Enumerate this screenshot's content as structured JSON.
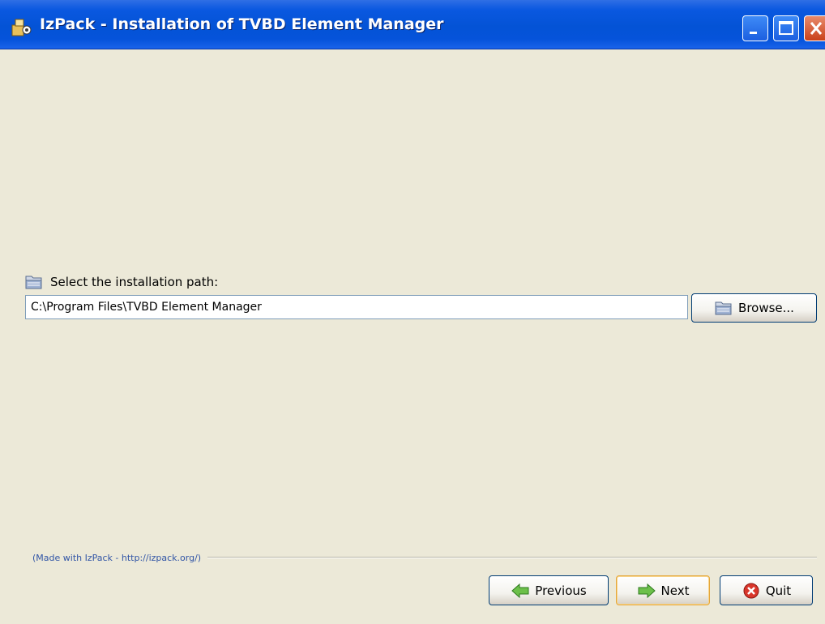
{
  "window": {
    "title": "IzPack - Installation of TVBD Element Manager",
    "icons": {
      "app": "izpack-app-icon",
      "minimize": "minimize-icon",
      "maximize": "maximize-icon",
      "close": "close-icon"
    }
  },
  "panel": {
    "path_label": "Select the installation path:",
    "path_value": "C:\\Program Files\\TVBD Element Manager",
    "browse_label": "Browse..."
  },
  "footer": {
    "made_with": "(Made with IzPack - http://izpack.org/)"
  },
  "buttons": {
    "previous_label": "Previous",
    "next_label": "Next",
    "quit_label": "Quit"
  },
  "colors": {
    "titlebar": "#0453d6",
    "background": "#ece9d8",
    "link_text": "#3155a6"
  }
}
